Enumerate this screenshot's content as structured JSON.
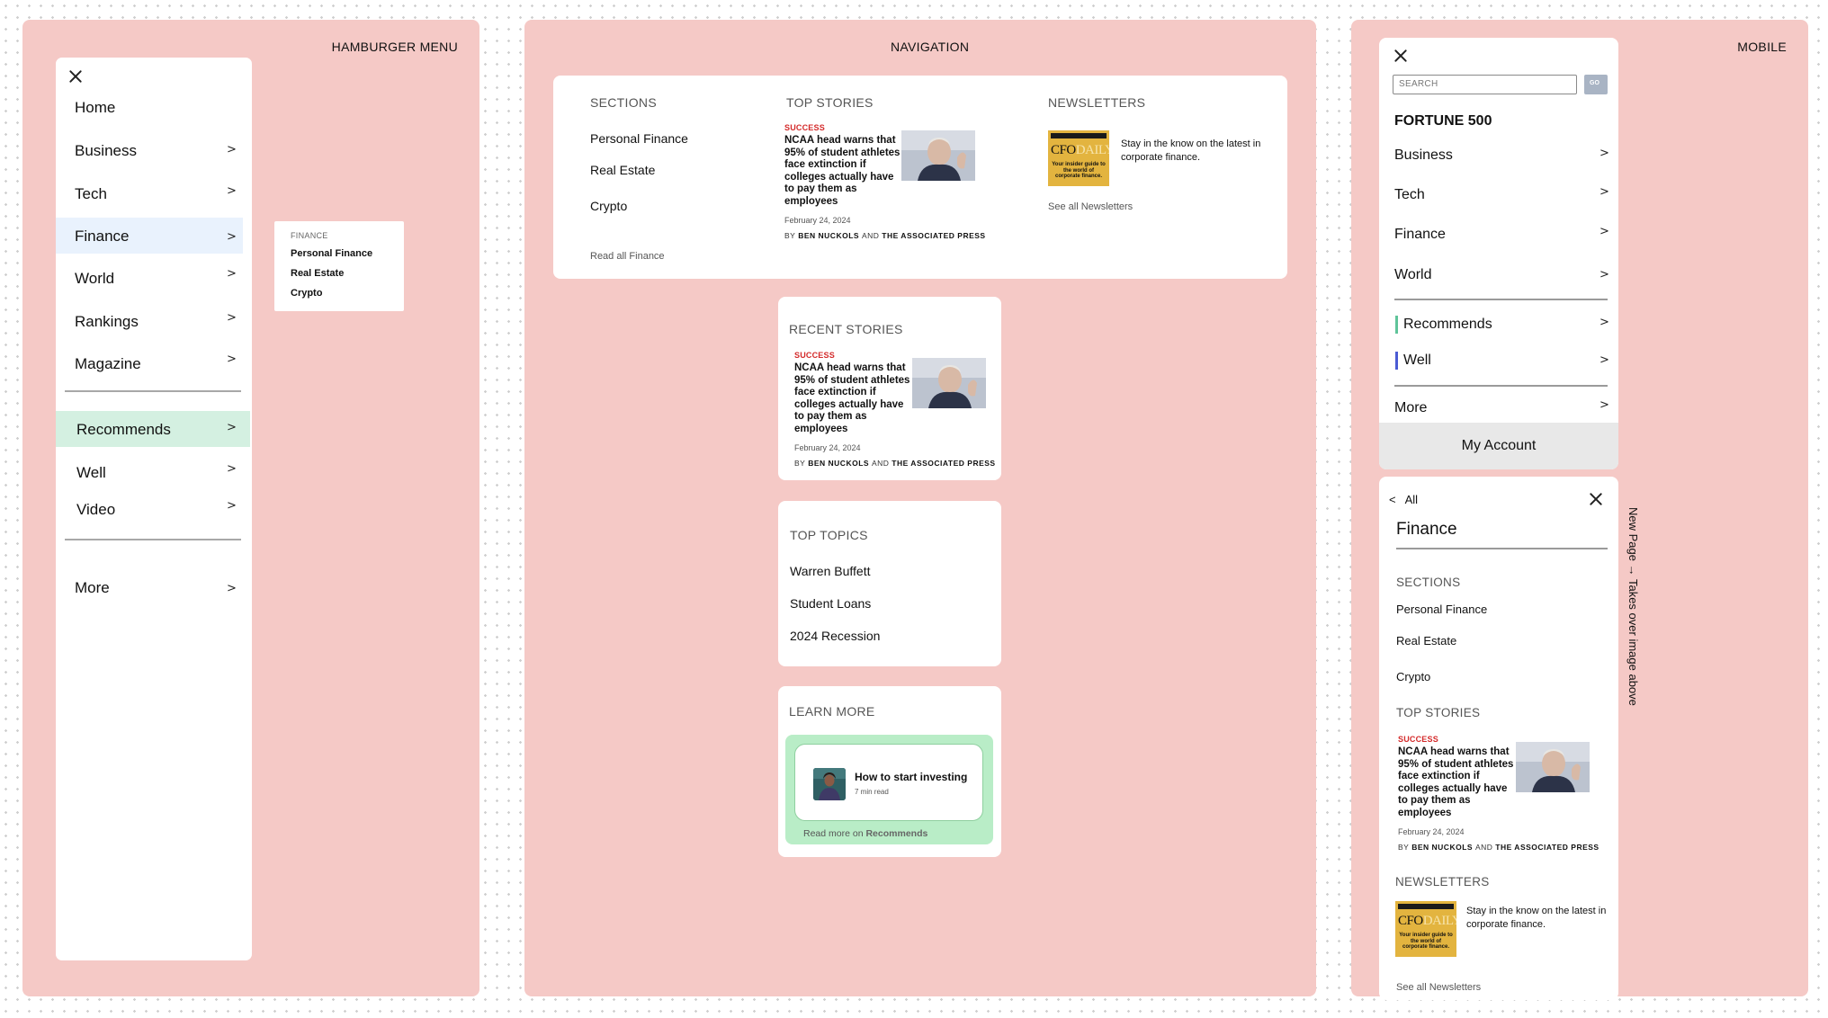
{
  "hamburger": {
    "title": "HAMBURGER MENU",
    "items": [
      {
        "label": "Home",
        "chevron": ""
      },
      {
        "label": "Business",
        "chevron": ">"
      },
      {
        "label": "Tech",
        "chevron": ">"
      },
      {
        "label": "Finance",
        "chevron": ">"
      },
      {
        "label": "World",
        "chevron": ">"
      },
      {
        "label": "Rankings",
        "chevron": ">"
      },
      {
        "label": "Magazine",
        "chevron": ">"
      }
    ],
    "recommends": {
      "label": "Recommends",
      "chevron": ">"
    },
    "well": {
      "label": "Well",
      "chevron": ">"
    },
    "video": {
      "label": "Video",
      "chevron": ">"
    },
    "more": {
      "label": "More",
      "chevron": ">"
    },
    "submenu": {
      "header": "FINANCE",
      "items": [
        "Personal Finance",
        "Real Estate",
        "Crypto"
      ]
    },
    "colors": {
      "active": "#e9f2fd",
      "recommends": "#d4f0e1"
    }
  },
  "navigation": {
    "title": "NAVIGATION",
    "sections": {
      "header": "SECTIONS",
      "items": [
        "Personal Finance",
        "Real Estate",
        "Crypto"
      ],
      "read_all": "Read all Finance"
    },
    "top_stories": {
      "header": "TOP STORIES",
      "tag": "SUCCESS",
      "headline": "NCAA head warns that 95% of student athletes face extinction if colleges actually have to pay them as employees",
      "date": "February 24, 2024",
      "by": "BY",
      "author1": "BEN NUCKOLS",
      "and": "AND",
      "author2": "THE ASSOCIATED PRESS"
    },
    "newsletters": {
      "header": "NEWSLETTERS",
      "logo_cfo": "CFO",
      "logo_daily": "DAILY",
      "logo_tagline": "Your insider guide to the world of corporate finance.",
      "description": "Stay in the know on the latest in corporate finance.",
      "see_all": "See all Newsletters"
    },
    "recent_stories": {
      "header": "RECENT STORIES",
      "tag": "SUCCESS",
      "headline": "NCAA head warns that 95% of student athletes face extinction if colleges actually have to pay them as employees",
      "date": "February 24, 2024",
      "by": "BY",
      "author1": "BEN NUCKOLS",
      "and": "AND",
      "author2": "THE ASSOCIATED PRESS"
    },
    "top_topics": {
      "header": "TOP TOPICS",
      "items": [
        "Warren Buffett",
        "Student Loans",
        "2024 Recession"
      ]
    },
    "learn_more": {
      "header": "LEARN MORE",
      "card_title": "How to start investing",
      "card_meta": "7 min read",
      "read_more_prefix": "Read more on",
      "read_more_link": "Recommends"
    }
  },
  "mobile": {
    "title": "MOBILE",
    "search": {
      "placeholder": "SEARCH",
      "button": "GO"
    },
    "brand": "FORTUNE 500",
    "items": [
      {
        "label": "Business",
        "chevron": ">"
      },
      {
        "label": "Tech",
        "chevron": ">"
      },
      {
        "label": "Finance",
        "chevron": ">"
      },
      {
        "label": "World",
        "chevron": ">"
      }
    ],
    "recommends": {
      "label": "Recommends",
      "chevron": ">",
      "color": "#5fc49a"
    },
    "well": {
      "label": "Well",
      "chevron": ">",
      "color": "#4a5bd4"
    },
    "more": {
      "label": "More",
      "chevron": ">"
    },
    "account": "My Account",
    "finance_page": {
      "back_icon": "<",
      "back_label": "All",
      "title": "Finance",
      "sections_header": "SECTIONS",
      "sections": [
        "Personal Finance",
        "Real Estate",
        "Crypto"
      ],
      "top_stories_header": "TOP STORIES",
      "tag": "SUCCESS",
      "headline": "NCAA head warns that 95% of student athletes face extinction if colleges actually have to pay them as employees",
      "date": "February 24, 2024",
      "by": "BY",
      "author1": "BEN NUCKOLS",
      "and": "AND",
      "author2": "THE ASSOCIATED PRESS",
      "newsletters_header": "NEWSLETTERS",
      "logo_cfo": "CFO",
      "logo_daily": "DAILY",
      "logo_tagline": "Your insider guide to the world of corporate finance.",
      "nl_description": "Stay in the know on the latest in corporate finance.",
      "see_all": "See all Newsletters"
    },
    "side_note": "New Page → Takes over image above"
  }
}
